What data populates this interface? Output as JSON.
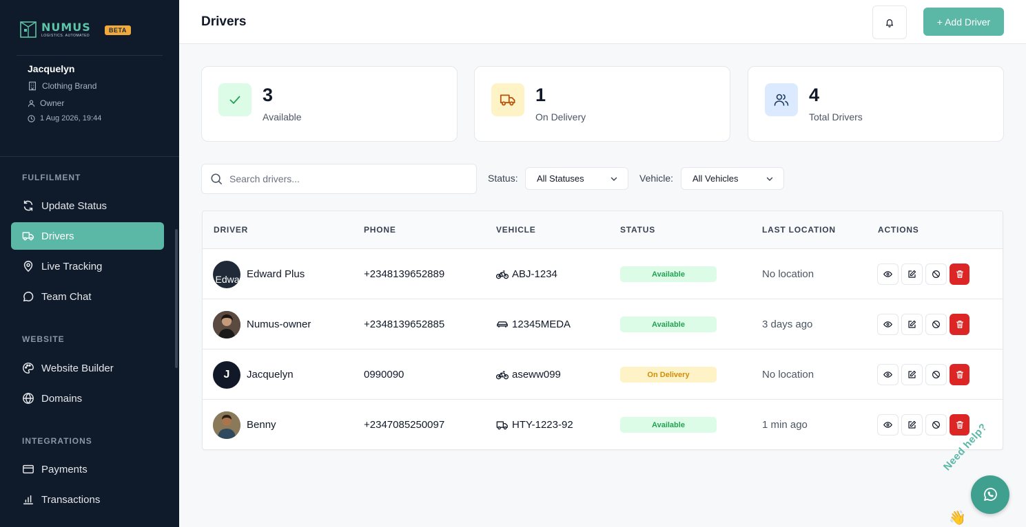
{
  "brand": {
    "name": "NUMUS",
    "tagline": "LOGISTICS. AUTOMATED",
    "badge": "BETA"
  },
  "user": {
    "name": "Jacquelyn",
    "brand": "Clothing Brand",
    "role": "Owner",
    "datetime": "1 Aug 2026, 19:44"
  },
  "sidebar": {
    "sections": [
      {
        "label": "FULFILMENT",
        "items": [
          {
            "label": "Update Status",
            "icon": "refresh-icon"
          },
          {
            "label": "Drivers",
            "icon": "truck-icon",
            "active": true
          },
          {
            "label": "Live Tracking",
            "icon": "map-pin-icon"
          },
          {
            "label": "Team Chat",
            "icon": "chat-icon"
          }
        ]
      },
      {
        "label": "WEBSITE",
        "items": [
          {
            "label": "Website Builder",
            "icon": "palette-icon"
          },
          {
            "label": "Domains",
            "icon": "globe-icon"
          }
        ]
      },
      {
        "label": "INTEGRATIONS",
        "items": [
          {
            "label": "Payments",
            "icon": "credit-card-icon"
          },
          {
            "label": "Transactions",
            "icon": "bar-chart-icon"
          }
        ]
      }
    ]
  },
  "header": {
    "title": "Drivers",
    "add_label": "+ Add Driver"
  },
  "stats": [
    {
      "value": "3",
      "label": "Available",
      "icon": "check-icon",
      "color": "#dcfce7",
      "icon_color": "#22a152"
    },
    {
      "value": "1",
      "label": "On Delivery",
      "icon": "truck-icon",
      "color": "#fef3c7",
      "icon_color": "#b45309"
    },
    {
      "value": "4",
      "label": "Total Drivers",
      "icon": "users-icon",
      "color": "#dbeafe",
      "icon_color": "#1e3a5f"
    }
  ],
  "filters": {
    "search_placeholder": "Search drivers...",
    "status_label": "Status:",
    "status_value": "All Statuses",
    "vehicle_label": "Vehicle:",
    "vehicle_value": "All Vehicles"
  },
  "table": {
    "columns": [
      "DRIVER",
      "PHONE",
      "VEHICLE",
      "STATUS",
      "LAST LOCATION",
      "ACTIONS"
    ],
    "rows": [
      {
        "name": "Edward Plus",
        "avatar_text": "Edwa",
        "phone": "+2348139652889",
        "vehicle": "ABJ-1234",
        "vehicle_icon": "bicycle-icon",
        "status": "Available",
        "location": "No location"
      },
      {
        "name": "Numus-owner",
        "avatar_text": "",
        "phone": "+2348139652885",
        "vehicle": "12345MEDA",
        "vehicle_icon": "car-icon",
        "status": "Available",
        "location": "3 days ago"
      },
      {
        "name": "Jacquelyn",
        "avatar_text": "J",
        "phone": "0990090",
        "vehicle": "aseww099",
        "vehicle_icon": "bicycle-icon",
        "status": "On Delivery",
        "location": "No location"
      },
      {
        "name": "Benny",
        "avatar_text": "",
        "phone": "+2347085250097",
        "vehicle": "HTY-1223-92",
        "vehicle_icon": "truck-icon",
        "status": "Available",
        "location": "1 min ago"
      }
    ]
  },
  "help": {
    "text": "Need help?",
    "emoji": "👋"
  }
}
